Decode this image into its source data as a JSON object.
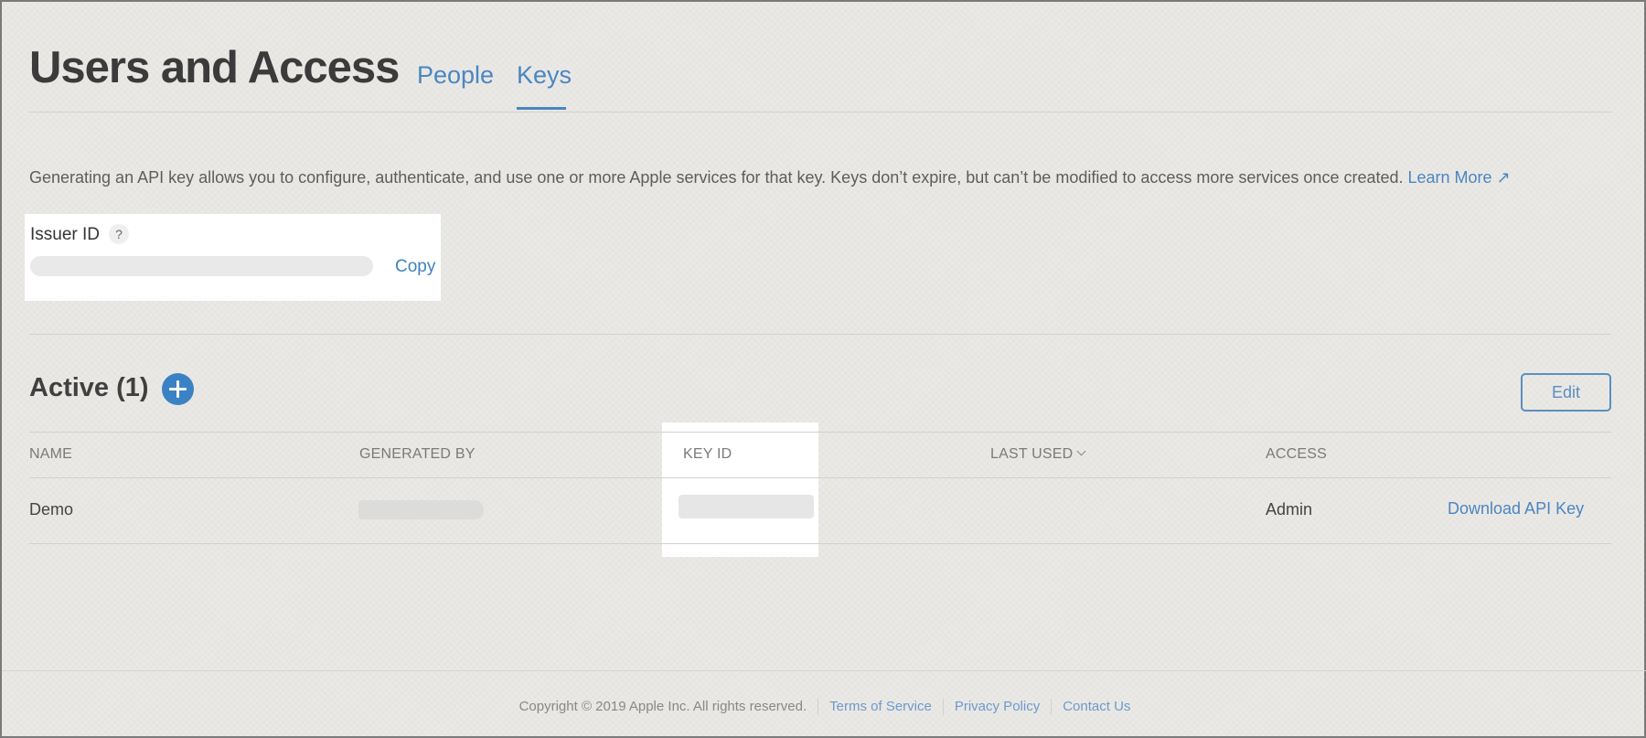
{
  "header": {
    "title": "Users and Access",
    "tabs": [
      {
        "label": "People",
        "active": false
      },
      {
        "label": "Keys",
        "active": true
      }
    ]
  },
  "intro": {
    "text": "Generating an API key allows you to configure, authenticate, and use one or more Apple services for that key. Keys don’t expire, but can’t be modified to access more services once created.",
    "learn_more": "Learn More ↗"
  },
  "issuer": {
    "label": "Issuer ID",
    "help_icon": "?",
    "value": "",
    "copy_label": "Copy"
  },
  "active_section": {
    "title": "Active (1)",
    "add_icon": "plus-circle-icon",
    "edit_label": "Edit"
  },
  "table": {
    "columns": [
      "NAME",
      "GENERATED BY",
      "KEY ID",
      "LAST USED",
      "ACCESS"
    ],
    "sort_icon": "chevron-down-icon",
    "rows": [
      {
        "name": "Demo",
        "generated_by": "",
        "key_id": "",
        "last_used": "",
        "access": "Admin",
        "action": "Download API Key"
      }
    ]
  },
  "footer": {
    "copyright": "Copyright © 2019 Apple Inc. All rights reserved.",
    "links": [
      "Terms of Service",
      "Privacy Policy",
      "Contact Us"
    ]
  },
  "colors": {
    "accent": "#4a86c0",
    "background": "#ebe9e6",
    "title": "#3b3b3b"
  }
}
